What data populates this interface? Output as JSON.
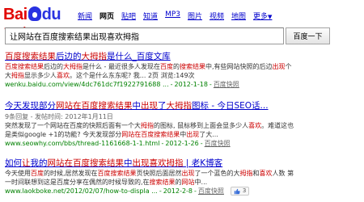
{
  "logo": {
    "text_left": "Bai",
    "text_right": "du",
    "cn": "百度"
  },
  "nav": {
    "items": [
      "新闻",
      "网页",
      "贴吧",
      "知道",
      "MP3",
      "图片",
      "视频",
      "地图"
    ],
    "active_index": 1,
    "more": "更多"
  },
  "search": {
    "query": "让网站在百度搜索结果出现喜欢拇指",
    "button": "百度一下"
  },
  "results": [
    {
      "title_parts": [
        "",
        "百度搜索结果",
        "后边的",
        "大拇指",
        "是什么_百度文库"
      ],
      "snippet": [
        {
          "t": "百度搜索结果",
          "hl": true
        },
        {
          "t": "后边的",
          "hl": false
        },
        {
          "t": "大拇指",
          "hl": true
        },
        {
          "t": "是什么 - 最近很多人发现在",
          "hl": false
        },
        {
          "t": "百度",
          "hl": true
        },
        {
          "t": "的",
          "hl": false
        },
        {
          "t": "搜索结果",
          "hl": true
        },
        {
          "t": "中,有些网站快照的后边",
          "hl": false
        },
        {
          "t": "出现",
          "hl": true
        },
        {
          "t": "个大",
          "hl": false
        },
        {
          "t": "拇指",
          "hl": true
        },
        {
          "t": "显示多少人",
          "hl": false
        },
        {
          "t": "喜欢",
          "hl": true
        },
        {
          "t": "。这个是什么东东呢? 我... 2页 浏览:149次",
          "hl": false
        }
      ],
      "url": "wenku.baidu.com/view/4dc761dc7f1922791688 ...",
      "date": "2012-1-18",
      "cache": "百度快照"
    },
    {
      "title_parts": [
        "今天发现部分",
        "网站在百度搜索结果",
        "中",
        "出现",
        "了",
        "大拇指",
        "图标 - 今日SEO话..."
      ],
      "meta": "9条回复 - 发帖时间: 2012年1月11日",
      "snippet": [
        {
          "t": "突然发现了一个网站在百度的快照后面有一个大",
          "hl": false
        },
        {
          "t": "拇指",
          "hl": true
        },
        {
          "t": "的图标, 鼠标移到上面会显多少人",
          "hl": false
        },
        {
          "t": "喜欢",
          "hl": true
        },
        {
          "t": "。难道这也是类似google +1的功能? 今天发现部分",
          "hl": false
        },
        {
          "t": "网站在百度搜索结果",
          "hl": true
        },
        {
          "t": "中",
          "hl": false
        },
        {
          "t": "出现",
          "hl": true
        },
        {
          "t": "了大...",
          "hl": false
        }
      ],
      "url": "www.seowhy.com/bbs/thread-1161668-1-1.html",
      "date": "2012-1-26",
      "cache": "百度快照"
    },
    {
      "title_parts": [
        "如何",
        "让",
        "我的",
        "网站在百度搜索结果",
        "中",
        "出现喜欢拇指",
        " | 老K博客"
      ],
      "snippet": [
        {
          "t": "今天使用",
          "hl": false
        },
        {
          "t": "百度",
          "hl": true
        },
        {
          "t": "的时候,居然发现在",
          "hl": false
        },
        {
          "t": "百度搜索结果",
          "hl": true
        },
        {
          "t": "页快照后面居然",
          "hl": false
        },
        {
          "t": "出现",
          "hl": true
        },
        {
          "t": "了一个蓝色的大",
          "hl": false
        },
        {
          "t": "拇指",
          "hl": true
        },
        {
          "t": "和",
          "hl": false
        },
        {
          "t": "喜欢",
          "hl": true
        },
        {
          "t": "人数 第一时间联想到这是百度分享在偶然的时候导致的,在",
          "hl": false
        },
        {
          "t": "搜索结果",
          "hl": true
        },
        {
          "t": "的",
          "hl": false
        },
        {
          "t": "网站",
          "hl": true
        },
        {
          "t": "中...",
          "hl": false
        }
      ],
      "url": "www.laokboke.net/2012/02/07/how-to-displa ...",
      "date": "2012-2-8",
      "cache": "百度快照",
      "like_count": "3"
    }
  ],
  "colors": {
    "link": "#0000cc",
    "highlight": "#cc0000",
    "url": "#008000",
    "brand_red": "#e10602",
    "brand_blue": "#2932e1"
  }
}
